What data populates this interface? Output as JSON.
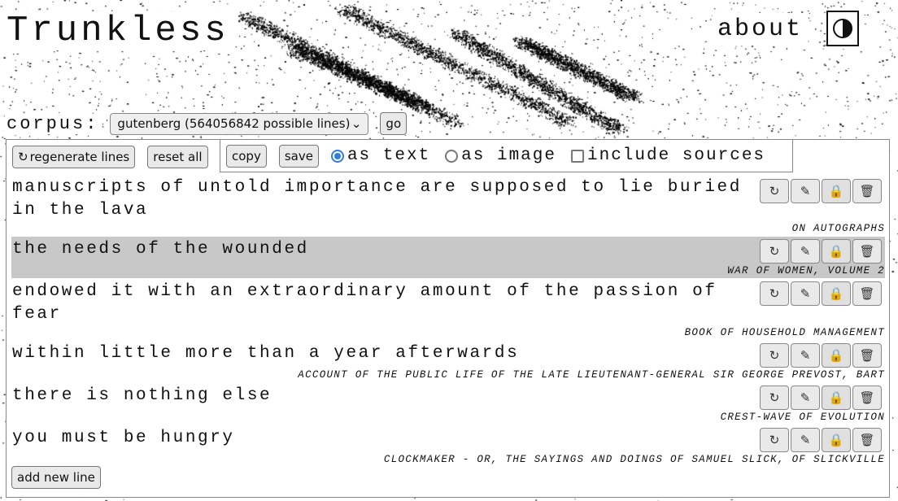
{
  "app": {
    "title": "Trunkless",
    "about_label": "about",
    "theme_icon": "contrast-icon"
  },
  "corpus": {
    "label": "corpus:",
    "selected": "gutenberg (564056842 possible lines)",
    "go_label": "go"
  },
  "toolbar": {
    "regenerate_label": "regenerate lines",
    "reset_label": "reset all",
    "copy_label": "copy",
    "save_label": "save",
    "as_text_label": "as text",
    "as_image_label": "as image",
    "include_sources_label": "include sources",
    "as_text_selected": true,
    "include_sources_checked": false
  },
  "lines": [
    {
      "text": "manuscripts of untold importance are supposed to lie buried in the lava",
      "source": "On Autographs",
      "highlighted": false
    },
    {
      "text": "the needs of the wounded",
      "source": "War of Women, Volume 2",
      "highlighted": true
    },
    {
      "text": "endowed it with an extraordinary amount of the passion of fear",
      "source": "Book of Household Management",
      "highlighted": false
    },
    {
      "text": "within little more than a year afterwards",
      "source": "Account of the Public Life of the Late Lieutenant-General Sir George Prevost, Bart",
      "highlighted": false
    },
    {
      "text": "there is nothing else",
      "source": "Crest-Wave of Evolution",
      "highlighted": false
    },
    {
      "text": "you must be hungry",
      "source": "Clockmaker - or, the Sayings and Doings of Samuel Slick, of Slickville",
      "highlighted": false
    }
  ],
  "line_actions": {
    "regenerate_icon": "refresh-icon",
    "edit_icon": "pencil-icon",
    "lock_icon": "lock-icon",
    "delete_icon": "trash-icon",
    "lock_color": "#f2a51a"
  },
  "add_line_label": "add new line",
  "colors": {
    "accent": "#2f7de1",
    "highlight_row": "#c8c8c8",
    "button_bg": "#e9e9e9"
  }
}
